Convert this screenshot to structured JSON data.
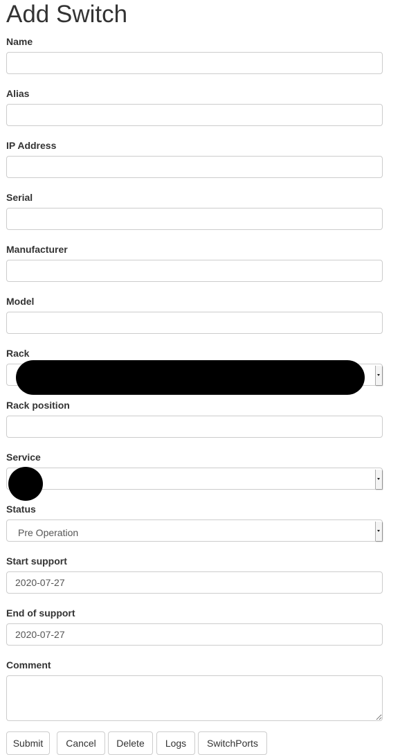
{
  "title": "Add Switch",
  "fields": [
    {
      "label": "Name",
      "value": ""
    },
    {
      "label": "Alias",
      "value": ""
    },
    {
      "label": "IP Address",
      "value": ""
    },
    {
      "label": "Serial",
      "value": ""
    },
    {
      "label": "Manufacturer",
      "value": ""
    },
    {
      "label": "Model",
      "value": ""
    },
    {
      "label": "Rack",
      "value": ""
    },
    {
      "label": "Rack position",
      "value": ""
    },
    {
      "label": "Service",
      "value": ""
    },
    {
      "label": "Status",
      "value": "Pre Operation"
    },
    {
      "label": "Start support",
      "value": "2020-07-27"
    },
    {
      "label": "End of support",
      "value": "2020-07-27"
    },
    {
      "label": "Comment",
      "value": ""
    }
  ],
  "buttons": {
    "submit": "Submit",
    "cancel": "Cancel",
    "delete": "Delete",
    "logs": "Logs",
    "switchports": "SwitchPorts"
  }
}
